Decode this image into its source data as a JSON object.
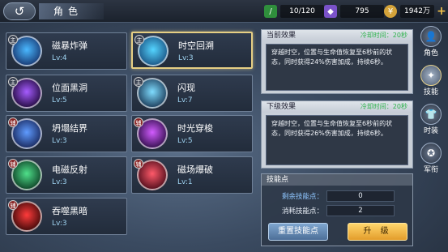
{
  "header": {
    "title": "角色",
    "back_icon": "↺",
    "stamina": "10/120",
    "gems": "795",
    "gold": "1942万"
  },
  "skills": [
    {
      "tag": "主",
      "type": "main",
      "name": "磁暴炸弹",
      "level": "Lv:4",
      "color1": "#4ab8ff",
      "color2": "#1a3f7a"
    },
    {
      "tag": "主",
      "type": "main",
      "name": "时空回溯",
      "level": "Lv:3",
      "color1": "#54d4ff",
      "color2": "#1e5c8c"
    },
    {
      "tag": "主",
      "type": "main",
      "name": "位面黑洞",
      "level": "Lv:5",
      "color1": "#a65cff",
      "color2": "#2a0f4a"
    },
    {
      "tag": "主",
      "type": "main",
      "name": "闪现",
      "level": "Lv:7",
      "color1": "#7fdcff",
      "color2": "#214563"
    },
    {
      "tag": "辅",
      "type": "aux",
      "name": "坍塌结界",
      "level": "Lv:3",
      "color1": "#5f9bff",
      "color2": "#1c2e66"
    },
    {
      "tag": "辅",
      "type": "aux",
      "name": "时光穿梭",
      "level": "Lv:5",
      "color1": "#d25cff",
      "color2": "#3c1357"
    },
    {
      "tag": "辅",
      "type": "aux",
      "name": "电磁反射",
      "level": "Lv:3",
      "color1": "#4fe08a",
      "color2": "#114a2c"
    },
    {
      "tag": "辅",
      "type": "aux",
      "name": "磁场爆破",
      "level": "Lv:1",
      "color1": "#ff5a6a",
      "color2": "#5a1220"
    },
    {
      "tag": "辅",
      "type": "aux",
      "name": "吞噬黑暗",
      "level": "Lv:3",
      "color1": "#ff3b3b",
      "color2": "#4a0c0c"
    }
  ],
  "current_effect": {
    "title": "当前效果",
    "cooldown": "冷却时间：20秒",
    "text": "穿越时空，位置与生命值恢复至6秒前的状态，同时获得24%伤害加成，持续6秒。"
  },
  "next_effect": {
    "title": "下级效果",
    "cooldown": "冷却时间：20秒",
    "text": "穿越时空，位置与生命值恢复至6秒前的状态，同时获得26%伤害加成，持续6秒。"
  },
  "skill_points": {
    "title": "技能点",
    "remaining_label": "剩余技能点：",
    "remaining": "0",
    "cost_label": "消耗技能点：",
    "cost": "2",
    "reset_label": "重置技能点",
    "upgrade_label": "升  级"
  },
  "right_tabs": [
    {
      "label": "角色",
      "icon": "👤"
    },
    {
      "label": "技能",
      "icon": "✦"
    },
    {
      "label": "时装",
      "icon": "👕"
    },
    {
      "label": "军衔",
      "icon": "✪"
    }
  ]
}
